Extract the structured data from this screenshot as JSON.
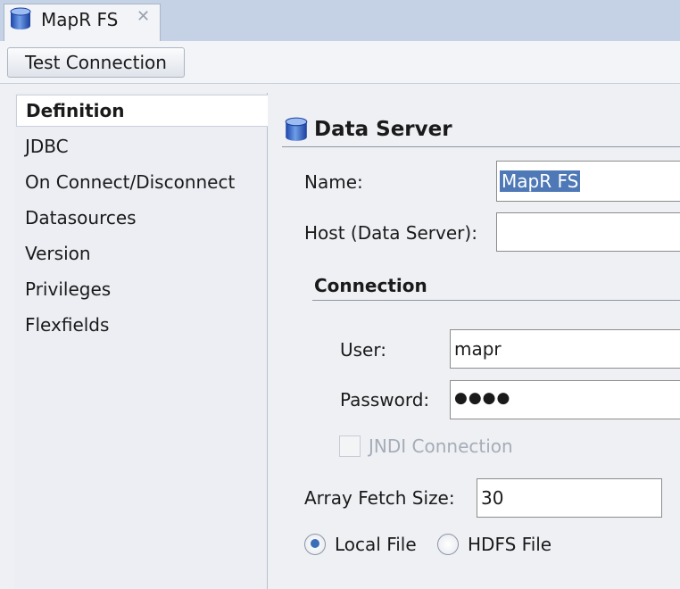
{
  "tab": {
    "title": "MapR FS",
    "close_glyph": "✕",
    "icon": "cylinder-icon"
  },
  "toolbar": {
    "test_connection_label": "Test Connection"
  },
  "nav": {
    "items": [
      {
        "label": "Definition",
        "selected": true
      },
      {
        "label": "JDBC"
      },
      {
        "label": "On Connect/Disconnect"
      },
      {
        "label": "Datasources"
      },
      {
        "label": "Version"
      },
      {
        "label": "Privileges"
      },
      {
        "label": "Flexfields"
      }
    ]
  },
  "data_server": {
    "title": "Data Server",
    "icon": "cylinder-icon",
    "name_label": "Name:",
    "name_value": "MapR FS",
    "host_label": "Host (Data Server):",
    "host_value": "",
    "connection": {
      "title": "Connection",
      "user_label": "User:",
      "user_value": "mapr",
      "password_label": "Password:",
      "password_mask": "●●●●",
      "jndi_label": "JNDI Connection",
      "jndi_checked": false
    },
    "array_fetch_label": "Array Fetch Size:",
    "array_fetch_value": "30",
    "radios": {
      "local_label": "Local File",
      "hdfs_label": "HDFS File",
      "selected": "Local File"
    }
  },
  "colors": {
    "tabstrip": "#c5d2e6",
    "selection": "#4e79b6",
    "icon_blue": "#2f5fc0"
  }
}
